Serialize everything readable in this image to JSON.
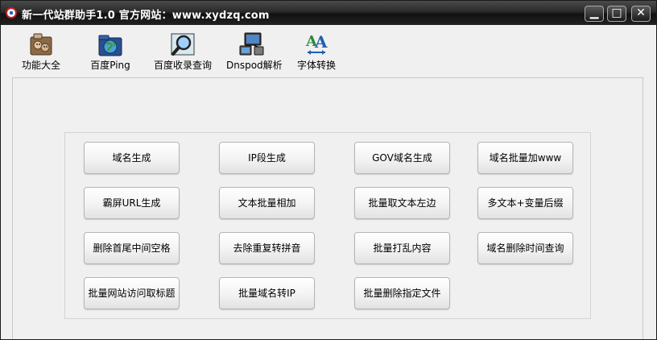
{
  "window": {
    "title": "新一代站群助手1.0  官方网站：www.xydzq.com",
    "min_label": "▁",
    "max_label": "□",
    "close_label": "✕"
  },
  "toolbar": {
    "items": [
      {
        "label": "功能大全",
        "icon": "toolbox-icon"
      },
      {
        "label": "百度Ping",
        "icon": "globe-folder-icon"
      },
      {
        "label": "百度收录查询",
        "icon": "magnifier-icon"
      },
      {
        "label": "Dnspod解析",
        "icon": "network-computer-icon"
      },
      {
        "label": "字体转换",
        "icon": "font-convert-icon"
      }
    ]
  },
  "buttons": [
    [
      "域名生成",
      "IP段生成",
      "GOV域名生成",
      "域名批量加www"
    ],
    [
      "霸屏URL生成",
      "文本批量相加",
      "批量取文本左边",
      "多文本+变量后缀"
    ],
    [
      "删除首尾中间空格",
      "去除重复转拼音",
      "批量打乱内容",
      "域名删除时间查询"
    ],
    [
      "批量网站访问取标题",
      "批量域名转IP",
      "批量删除指定文件"
    ]
  ],
  "colors": {
    "titlebar": "#1a1a1a",
    "window_bg": "#f0f0f0"
  }
}
